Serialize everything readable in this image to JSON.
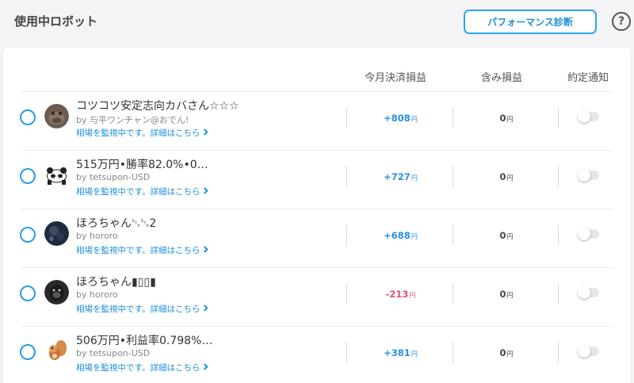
{
  "header": {
    "title": "使用中ロボット",
    "diagnosis_button": "パフォーマンス診断",
    "help_icon_text": "?"
  },
  "columns": {
    "settled": "今月決済損益",
    "unrealized": "含み損益",
    "notify": "約定通知"
  },
  "robots": [
    {
      "name": "コツコツ安定志向カバさん☆☆☆",
      "author": "by 与平ワンチャン@おでん!",
      "status": "相場を監視中です。詳細はこちら",
      "settled": "+808",
      "settled_unit": "円",
      "unrealized": "0",
      "unrealized_unit": "円",
      "avatar_icon": "hippo-avatar-icon"
    },
    {
      "name": "515万円•勝率82.0%•0…",
      "author": "by tetsupon-USD",
      "status": "相場を監視中です。詳細はこちら",
      "settled": "+727",
      "settled_unit": "円",
      "unrealized": "0",
      "unrealized_unit": "円",
      "avatar_icon": "panda-avatar-icon"
    },
    {
      "name": "ほろちゃん␂␂2",
      "author": "by hororo",
      "status": "相場を監視中です。詳細はこちら",
      "settled": "+688",
      "settled_unit": "円",
      "unrealized": "0",
      "unrealized_unit": "円",
      "avatar_icon": "dark-avatar-icon"
    },
    {
      "name": "ほろちゃん▮▯▯▮",
      "author": "by hororo",
      "status": "相場を監視中です。詳細はこちら",
      "settled": "-213",
      "settled_unit": "円",
      "unrealized": "0",
      "unrealized_unit": "円",
      "avatar_icon": "gorilla-avatar-icon"
    },
    {
      "name": "506万円•利益率0.798%…",
      "author": "by tetsupon-USD",
      "status": "相場を監視中です。詳細はこちら",
      "settled": "+381",
      "settled_unit": "円",
      "unrealized": "0",
      "unrealized_unit": "円",
      "avatar_icon": "squirrel-avatar-icon"
    }
  ],
  "colors": {
    "accent": "#2a8fe0",
    "positive": "#2a8fe0",
    "negative": "#e0506e"
  }
}
